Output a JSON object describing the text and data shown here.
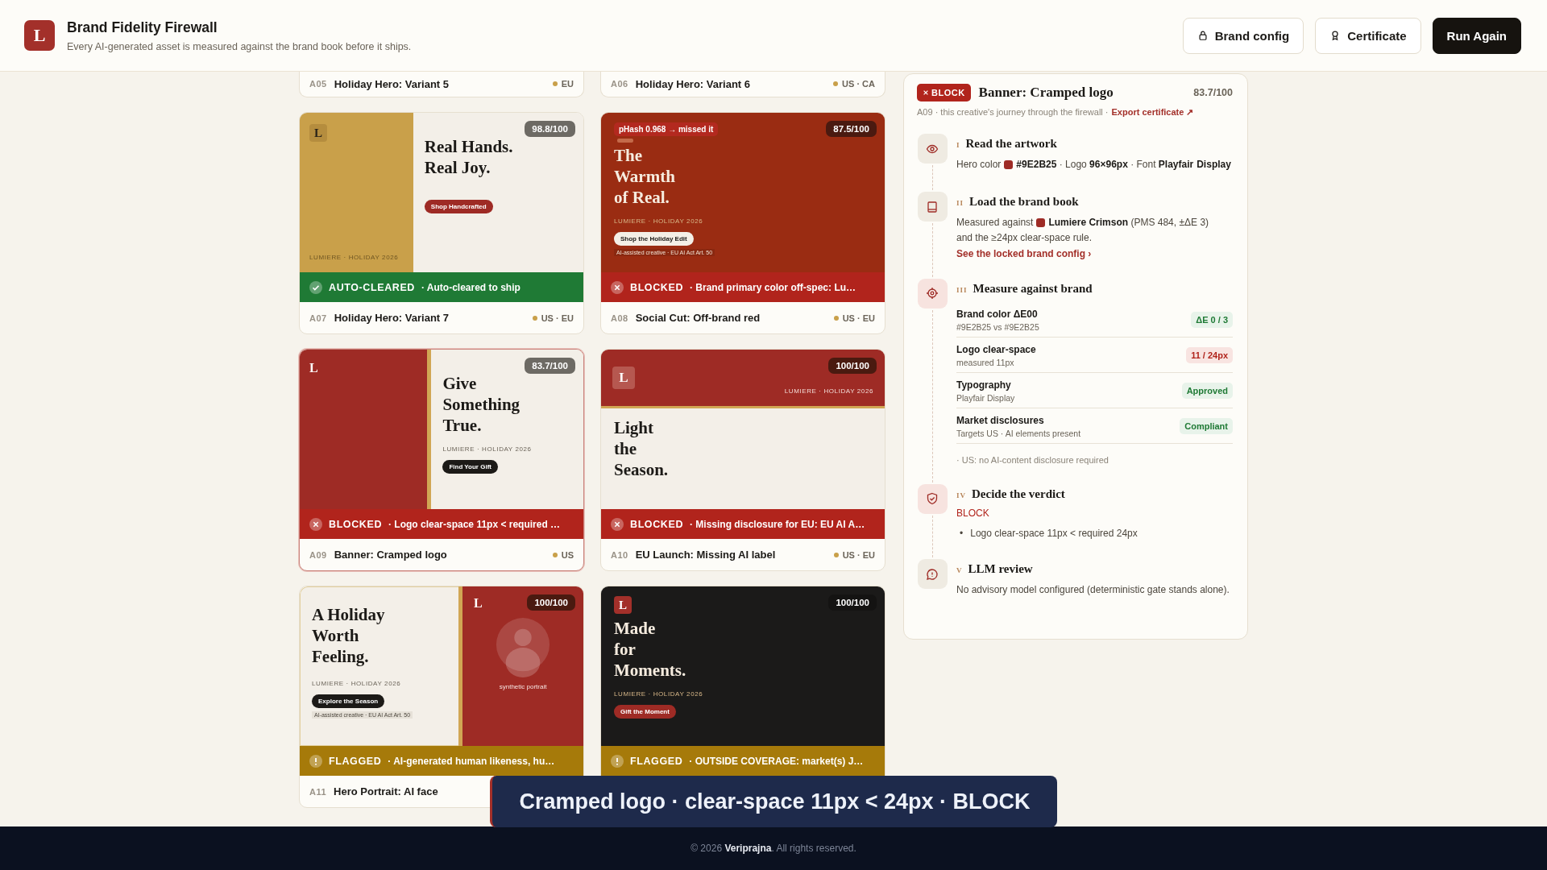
{
  "header": {
    "logo": "L",
    "title": "Brand Fidelity Firewall",
    "subtitle": "Every AI-generated asset is measured against the brand book before it ships.",
    "buttons": [
      {
        "label": "Brand config",
        "kind": "config"
      },
      {
        "label": "Certificate",
        "kind": "certificate"
      },
      {
        "label": "Run Again",
        "kind": "primary"
      }
    ]
  },
  "partial_cards": [
    {
      "id": "A05",
      "title": "Holiday Hero: Variant 5",
      "markets": "EU"
    },
    {
      "id": "A06",
      "title": "Holiday Hero: Variant 6",
      "markets": "US · CA"
    }
  ],
  "cards": [
    {
      "id": "A07",
      "title": "Holiday Hero: Variant 7",
      "markets": "US · EU",
      "score": "98.8/100",
      "selected": false,
      "status": {
        "kind": "cleared",
        "label": "AUTO-CLEARED",
        "message": "· Auto-cleared to ship"
      },
      "art": {
        "kind": "split-gold",
        "logo": "L",
        "headline": "Real Hands.\nReal Joy.",
        "tagline": "LUMIERE · HOLIDAY 2026",
        "cta": "Shop Handcrafted"
      }
    },
    {
      "id": "A08",
      "title": "Social Cut: Off-brand red",
      "markets": "US · EU",
      "score": "87.5/100",
      "selected": false,
      "status": {
        "kind": "blocked",
        "label": "BLOCKED",
        "message": "· Brand primary color off-spec: Lu…"
      },
      "art": {
        "kind": "full-red",
        "chip": "pHash 0.968 → missed it",
        "headline": "The\nWarmth\nof Real.",
        "tagline": "LUMIERE · HOLIDAY 2026",
        "cta": "Shop the Holiday Edit",
        "disclosure": "AI-assisted creative · EU AI Act Art. 50"
      }
    },
    {
      "id": "A09",
      "title": "Banner: Cramped logo",
      "markets": "US",
      "score": "83.7/100",
      "selected": true,
      "status": {
        "kind": "blocked",
        "label": "BLOCKED",
        "message": "· Logo clear-space 11px < required …"
      },
      "art": {
        "kind": "split-red",
        "logo": "L",
        "headline": "Give\nSomething\nTrue.",
        "tagline": "LUMIERE · HOLIDAY 2026",
        "cta": "Find Your Gift"
      }
    },
    {
      "id": "A10",
      "title": "EU Launch: Missing AI label",
      "markets": "US · EU",
      "score": "100/100",
      "selected": false,
      "status": {
        "kind": "blocked",
        "label": "BLOCKED",
        "message": "· Missing disclosure for EU: EU AI A…"
      },
      "art": {
        "kind": "band",
        "logo": "L",
        "tagline": "LUMIERE · HOLIDAY 2026",
        "headline": "Light\nthe\nSeason."
      }
    },
    {
      "id": "A11",
      "title": "Hero Portrait: AI face",
      "score": "100/100",
      "selected": false,
      "status": {
        "kind": "flagged",
        "label": "FLAGGED",
        "message": "· AI-generated human likeness, hu…"
      },
      "art": {
        "kind": "portrait",
        "logo": "L",
        "headline": "A Holiday\nWorth\nFeeling.",
        "tagline": "LUMIERE · HOLIDAY 2026",
        "cta": "Explore the Season",
        "disclosure": "AI-assisted creative · EU AI Act Art. 50",
        "portrait_label": "synthetic portrait"
      }
    },
    {
      "score": "100/100",
      "selected": false,
      "status": {
        "kind": "flagged",
        "label": "FLAGGED",
        "message": "· OUTSIDE COVERAGE: market(s) J…"
      },
      "art": {
        "kind": "full-dark",
        "logo": "L",
        "headline": "Made\nfor\nMoments.",
        "tagline": "LUMIERE · HOLIDAY 2026",
        "cta": "Gift the Moment"
      }
    }
  ],
  "panel": {
    "verdict": "BLOCK",
    "title": "Banner: Cramped logo",
    "score": "83.7/100",
    "subtitle": "A09 · this creative's journey through the firewall ·",
    "link": "Export certificate ↗",
    "steps": [
      {
        "numeral": "I",
        "title": "Read the artwork",
        "kind": "eye",
        "body": [
          {
            "text": "Hero color"
          },
          {
            "color": "#9e2b25"
          },
          {
            "text": "**#9E2B25** · Logo **96×96px** · Font **Playfair**"
          },
          {
            "text": "**Display**"
          }
        ]
      },
      {
        "numeral": "II",
        "title": "Load the brand book",
        "kind": "book",
        "body": [
          {
            "text": "Measured against"
          },
          {
            "color": "#9e2b25"
          },
          {
            "text": "**Lumiere Crimson** (PMS 484, ±ΔE 3)"
          },
          {
            "text": "and the ≥24px clear-space rule."
          }
        ],
        "link": "See the locked brand config ›"
      },
      {
        "numeral": "III",
        "title": "Measure against brand",
        "kind": "target",
        "checks": [
          {
            "label": "Brand color ΔE00",
            "detail": "#9E2B25 vs #9E2B25",
            "value": "ΔE 0 / 3",
            "passed": true
          },
          {
            "label": "Logo clear-space",
            "detail": "measured 11px",
            "value": "11 / 24px",
            "passed": false
          },
          {
            "label": "Typography",
            "detail": "Playfair Display",
            "value": "Approved",
            "passed": true
          },
          {
            "label": "Market disclosures",
            "detail": "Targets US · AI elements present",
            "value": "Compliant",
            "passed": true
          }
        ],
        "note": "· US: no AI-content disclosure required"
      },
      {
        "numeral": "IV",
        "title": "Decide the verdict",
        "kind": "shield",
        "verdict": "BLOCK",
        "bullets": [
          {
            "marker": "•",
            "text": "Logo clear-space 11px < required 24px"
          }
        ]
      },
      {
        "numeral": "V",
        "title": "LLM review",
        "kind": "chat",
        "body": [
          {
            "text": "No advisory model configured (deterministic gate stands alone)."
          }
        ]
      }
    ]
  },
  "toast": {
    "text": "Cramped logo · clear-space 11px < 24px · BLOCK"
  },
  "footer": {
    "text": "© 2026 **Veriprajna**. All rights reserved."
  }
}
